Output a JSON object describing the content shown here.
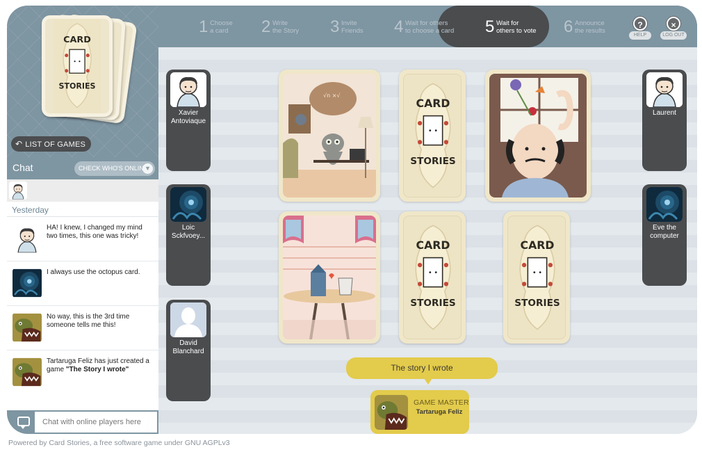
{
  "sidebar": {
    "list_games_label": "LIST OF GAMES",
    "chat_title": "Chat",
    "check_online_label": "CHECK WHO'S ONLINE",
    "day_label": "Yesterday",
    "messages": [
      {
        "text": "HA! I knew, I changed my mind two times, this one was tricky!",
        "avatar": "cartoon-man-avatar"
      },
      {
        "text": "I always use the octopus card.",
        "avatar": "octopus-avatar"
      },
      {
        "text": "No way, this is the 3rd time someone tells me this!",
        "avatar": "tortoise-avatar"
      },
      {
        "text_prefix": "Tartaruga Feliz has just created a game ",
        "text_bold": "\"The Story I wrote\"",
        "avatar": "tortoise-avatar"
      }
    ],
    "chat_placeholder": "Chat with online players here"
  },
  "steps": [
    {
      "num": "1",
      "line1": "Choose",
      "line2": "a card"
    },
    {
      "num": "2",
      "line1": "Write",
      "line2": "the Story"
    },
    {
      "num": "3",
      "line1": "Invite",
      "line2": "Friends"
    },
    {
      "num": "4",
      "line1": "Wait for others",
      "line2": "to choose a card"
    },
    {
      "num": "5",
      "line1": "Wait for",
      "line2": "others to vote",
      "active": true
    },
    {
      "num": "6",
      "line1": "Announce",
      "line2": "the results"
    }
  ],
  "header_buttons": {
    "help": "HELP",
    "logout": "LOG OUT"
  },
  "players_left": [
    {
      "name": "Xavier Antoviaque",
      "avatar": "cartoon-man-avatar"
    },
    {
      "name": "Loic Sckfvoey...",
      "avatar": "octopus-avatar"
    },
    {
      "name": "David Blanchard",
      "avatar": "default-silhouette-avatar"
    }
  ],
  "players_right": [
    {
      "name": "Laurent",
      "avatar": "cartoon-man-avatar"
    },
    {
      "name": "Eve the computer",
      "avatar": "octopus-avatar"
    }
  ],
  "cards": [
    {
      "kind": "illustration",
      "subject": "cat-professor-card"
    },
    {
      "kind": "back",
      "subject": "card-back"
    },
    {
      "kind": "illustration",
      "subject": "man-with-flower-card"
    },
    {
      "kind": "illustration",
      "subject": "milk-and-cup-card"
    },
    {
      "kind": "back",
      "subject": "card-back"
    },
    {
      "kind": "back",
      "subject": "card-back"
    }
  ],
  "story": {
    "title": "The story I wrote"
  },
  "game_master": {
    "title": "GAME MASTER",
    "name": "Tartaruga Feliz",
    "avatar": "tortoise-avatar"
  },
  "footer": {
    "text": "Powered by Card Stories, a free software game under GNU AGPLv3"
  },
  "colors": {
    "slate": "#7e95a2",
    "dark": "#4a4c4e",
    "gold": "#e3cb4c",
    "card": "#f0e7c9"
  }
}
